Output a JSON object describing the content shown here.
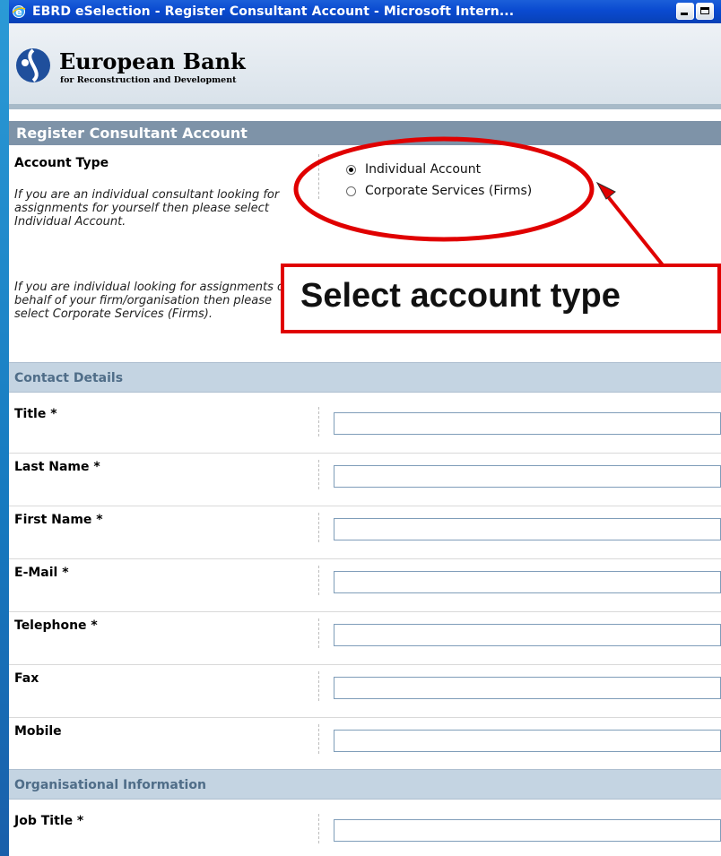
{
  "window": {
    "title": "EBRD eSelection - Register Consultant Account - Microsoft Intern...",
    "titlebar_color": "#0a4ad0"
  },
  "banner": {
    "org_name": "European Bank",
    "org_subtitle": "for Reconstruction and Development"
  },
  "page": {
    "title": "Register Consultant Account"
  },
  "account_type": {
    "label": "Account Type",
    "help_individual": "If you are an individual consultant looking for assignments for yourself then please select Individual Account.",
    "help_corporate": "If you are individual looking for assignments on behalf of your firm/organisation then please select Corporate Services (Firms).",
    "options": [
      {
        "label": "Individual Account",
        "checked": true
      },
      {
        "label": "Corporate Services (Firms)",
        "checked": false
      }
    ]
  },
  "contact_details": {
    "heading": "Contact Details",
    "fields": [
      {
        "label": "Title *",
        "value": ""
      },
      {
        "label": "Last Name *",
        "value": ""
      },
      {
        "label": "First Name *",
        "value": ""
      },
      {
        "label": "E-Mail *",
        "value": ""
      },
      {
        "label": "Telephone *",
        "value": ""
      },
      {
        "label": "Fax",
        "value": ""
      },
      {
        "label": "Mobile",
        "value": ""
      }
    ]
  },
  "organisational_information": {
    "heading": "Organisational Information",
    "fields": [
      {
        "label": "Job Title *",
        "value": ""
      }
    ]
  },
  "annotation": {
    "callout_text": "Select account type",
    "highlight_color": "#e00000"
  }
}
